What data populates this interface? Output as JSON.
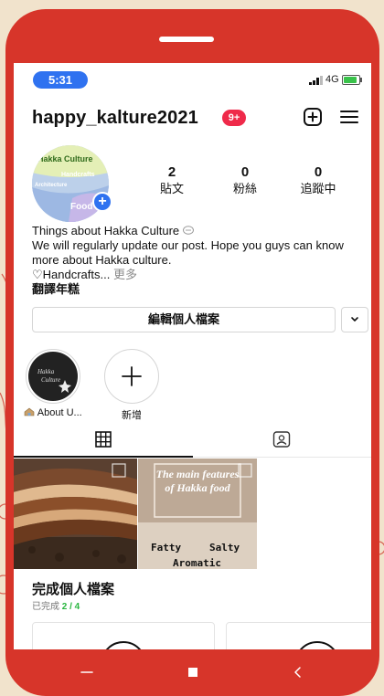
{
  "status_bar": {
    "time": "5:31",
    "network": "4G",
    "battery_level": 0.8,
    "signal-icon": "signal-bars-icon",
    "battery-icon": "battery-charging-icon"
  },
  "header": {
    "username": "happy_kalture2021",
    "notification_badge": "9+",
    "new_post_icon": "plus-square-icon",
    "menu_icon": "hamburger-menu-icon"
  },
  "avatar": {
    "texts": [
      "Hakka Culture",
      "Handcrafts",
      "Architecture",
      "Food"
    ]
  },
  "stats": [
    {
      "value": "2",
      "label": "貼文"
    },
    {
      "value": "0",
      "label": "粉絲"
    },
    {
      "value": "0",
      "label": "追蹤中"
    }
  ],
  "bio": {
    "line1": "Things about Hakka Culture",
    "line2": "We will regularly update our post. Hope you guys can know more about Hakka culture.",
    "line3": "♡Handcrafts...",
    "more": "更多",
    "translate": "翻譯年糕"
  },
  "buttons": {
    "edit_profile": "編輯個人檔案",
    "dropdown_icon": "chevron-down-icon"
  },
  "highlights": [
    {
      "label": "About U...",
      "cover_texts": [
        "Hakka",
        "Culture"
      ]
    },
    {
      "label": "新增"
    }
  ],
  "tabs": {
    "grid_icon": "grid-icon",
    "tagged_icon": "tagged-person-icon",
    "active": "grid"
  },
  "posts": [
    {
      "kind": "photo",
      "subject": "braised pork"
    },
    {
      "title": "The main features of Hakka food",
      "tags": [
        "Fatty",
        "Salty",
        "Aromatic"
      ]
    }
  ],
  "complete_profile": {
    "title": "完成個人檔案",
    "subtitle_prefix": "已完成",
    "progress": "2 / 4"
  },
  "colors": {
    "phone_frame": "#d7352a",
    "background": "#f1e3cc",
    "accent_blue": "#2f72f0",
    "badge_red": "#ef2a4a",
    "progress_green": "#27b53e"
  },
  "navbar": {
    "recent_icon": "recent-apps-icon",
    "home_icon": "home-square-icon",
    "back_icon": "back-chevron-icon"
  }
}
